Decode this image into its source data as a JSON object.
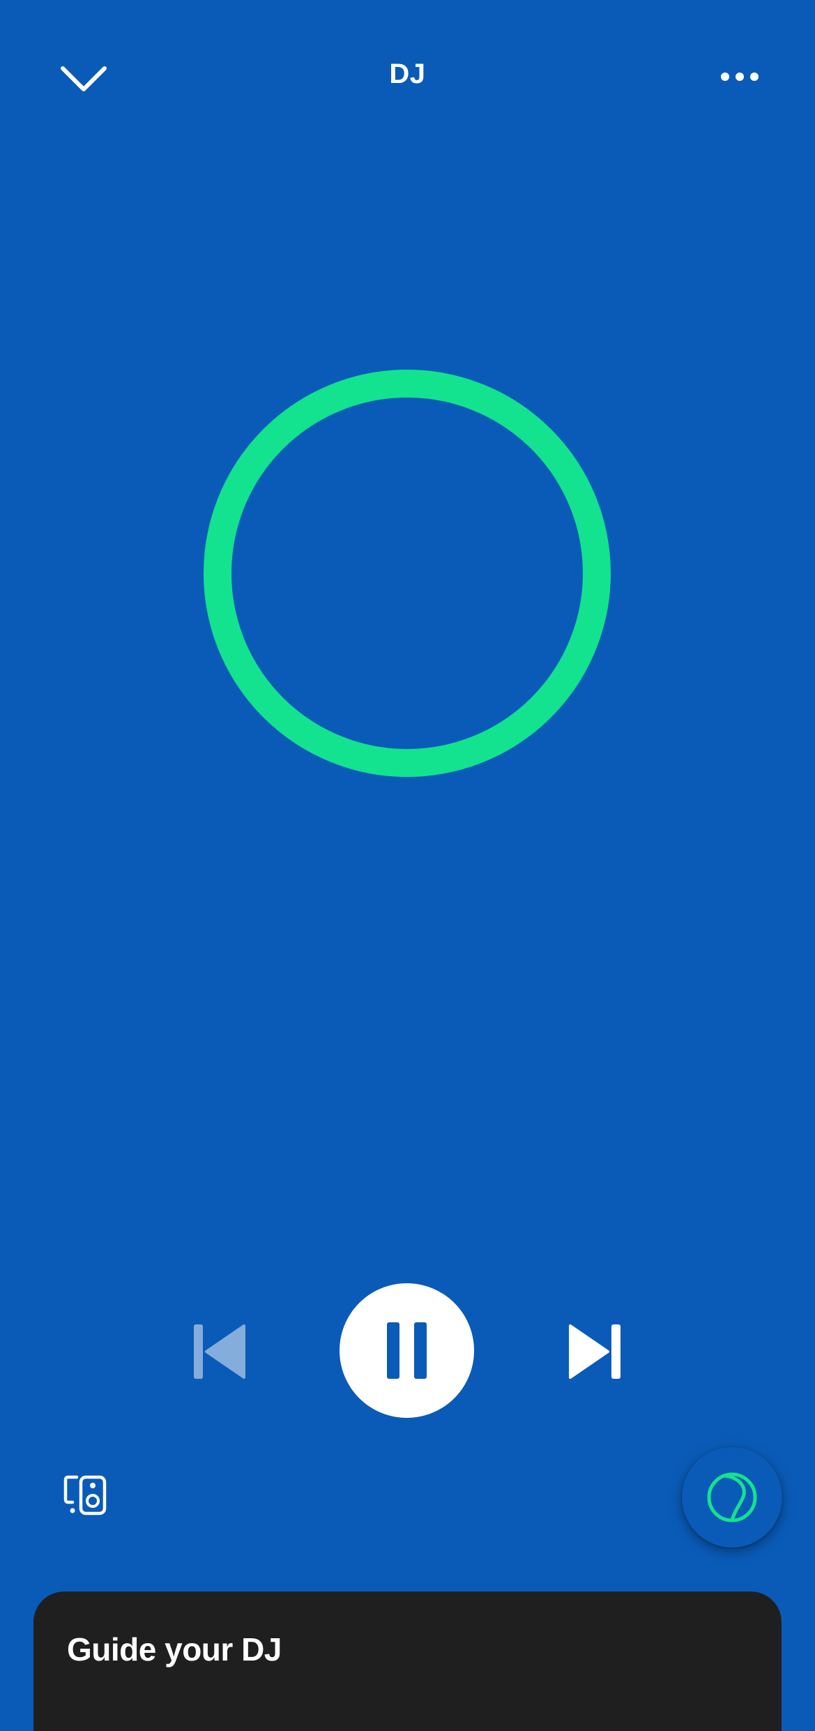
{
  "header": {
    "title": "DJ",
    "collapse_icon": "chevron-down-icon",
    "more_icon": "more-horizontal-icon"
  },
  "artwork": {
    "icon": "dj-ring-icon",
    "ring_color": "#13e38f"
  },
  "playback": {
    "prev_icon": "skip-previous-icon",
    "prev_enabled": false,
    "play_state": "playing",
    "pause_icon": "pause-icon",
    "next_icon": "skip-next-icon"
  },
  "footer": {
    "devices_icon": "connect-devices-icon",
    "dj_icon": "dj-voice-icon"
  },
  "guide": {
    "title": "Guide your DJ"
  },
  "colors": {
    "background": "#0a5bb8",
    "accent": "#13e38f",
    "sheet": "#1f1f1f",
    "text": "#ffffff"
  }
}
